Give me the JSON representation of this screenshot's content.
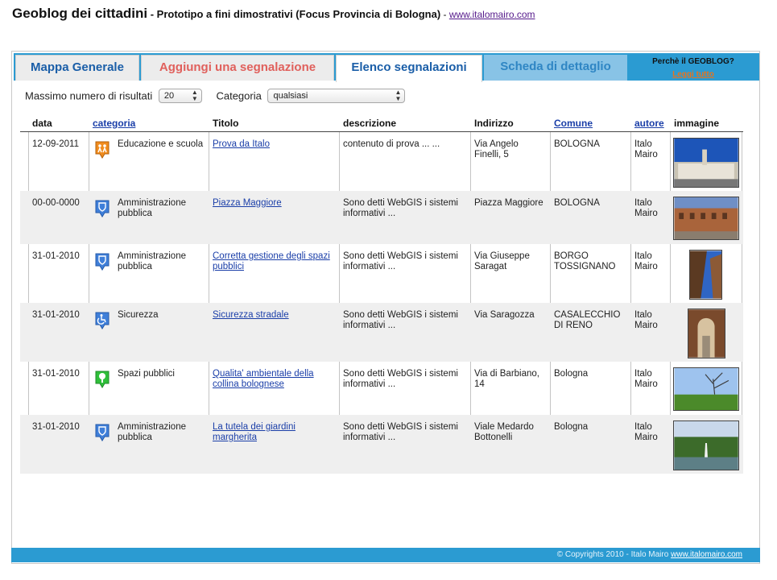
{
  "header": {
    "title": "Geoblog dei cittadini",
    "subtitle": " - Prototipo a fini dimostrativi (Focus Provincia di Bologna)",
    "separator": " - ",
    "link": "www.italomairo.com"
  },
  "tabs": {
    "mappa": "Mappa Generale",
    "aggiungi": "Aggiungi una segnalazione",
    "elenco": "Elenco segnalazioni",
    "scheda": "Scheda di dettaglio"
  },
  "why": {
    "title": "Perchè il GEOBLOG?",
    "link": "Leggi tutto"
  },
  "filters": {
    "max_label": "Massimo numero di risultati",
    "max_value": "20",
    "category_label": "Categoria",
    "category_value": "qualsiasi"
  },
  "columns": {
    "data": "data",
    "categoria": "categoria",
    "titolo": "Titolo",
    "descrizione": "descrizione",
    "indirizzo": "Indirizzo",
    "comune": "Comune",
    "autore": "autore",
    "immagine": "immagine"
  },
  "rows": [
    {
      "date": "12-09-2011",
      "category": "Educazione e scuola",
      "category_icon": "school-icon",
      "icon_color": "#f08c1e",
      "title": "Prova da Italo",
      "description": "contenuto di prova ... ...",
      "address": "Via Angelo Finelli, 5",
      "comune": "BOLOGNA",
      "author": "Italo Mairo"
    },
    {
      "date": "00-00-0000",
      "category": "Amministrazione pubblica",
      "category_icon": "shield-icon",
      "icon_color": "#3f7fd9",
      "title": "Piazza Maggiore",
      "description": "Sono detti WebGIS i sistemi informativi ...",
      "address": "Piazza Maggiore",
      "comune": "BOLOGNA",
      "author": "Italo Mairo"
    },
    {
      "date": "31-01-2010",
      "category": "Amministrazione pubblica",
      "category_icon": "shield-icon",
      "icon_color": "#3f7fd9",
      "title": "Corretta gestione degli spazi pubblici",
      "description": "Sono detti WebGIS i sistemi informativi ...",
      "address": "Via Giuseppe Saragat",
      "comune": "BORGO TOSSIGNANO",
      "author": "Italo Mairo"
    },
    {
      "date": "31-01-2010",
      "category": "Sicurezza",
      "category_icon": "accessibility-icon",
      "icon_color": "#3f7fd9",
      "title": "Sicurezza stradale",
      "description": "Sono detti WebGIS i sistemi informativi ...",
      "address": "Via Saragozza",
      "comune": "CASALECCHIO DI RENO",
      "author": "Italo Mairo"
    },
    {
      "date": "31-01-2010",
      "category": "Spazi pubblici",
      "category_icon": "tree-icon",
      "icon_color": "#2fbf3a",
      "title": "Qualita' ambientale della collina bolognese",
      "description": "Sono detti WebGIS i sistemi informativi ...",
      "address": "Via di Barbiano, 14",
      "comune": "Bologna",
      "author": "Italo Mairo"
    },
    {
      "date": "31-01-2010",
      "category": "Amministrazione pubblica",
      "category_icon": "shield-icon",
      "icon_color": "#3f7fd9",
      "title": "La tutela dei giardini margherita",
      "description": "Sono detti WebGIS i sistemi informativi ...",
      "address": "Viale Medardo Bottonelli",
      "comune": "Bologna",
      "author": "Italo Mairo"
    }
  ],
  "footer": {
    "text": "© Copyrights 2010 - Italo Mairo ",
    "link": "www.italomairo.com"
  }
}
